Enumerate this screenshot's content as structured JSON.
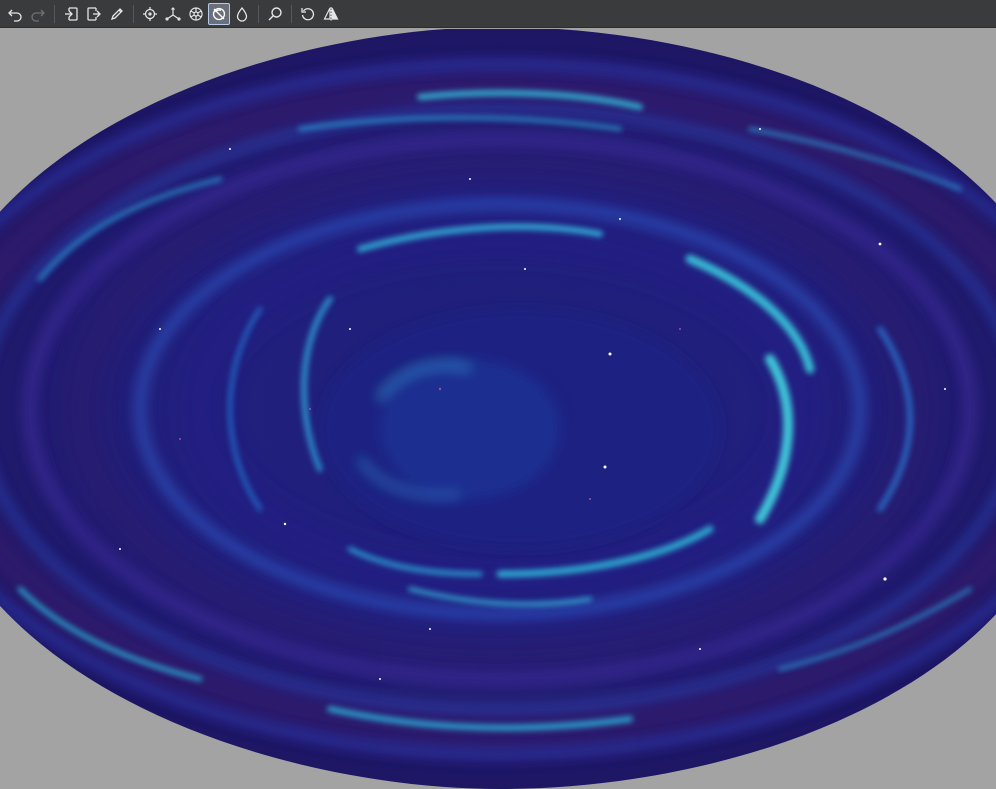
{
  "toolbar": {
    "buttons": [
      {
        "name": "undo-button",
        "icon": "undo-icon",
        "enabled": true
      },
      {
        "name": "redo-button",
        "icon": "redo-icon",
        "enabled": false
      },
      {
        "name": "import-button",
        "icon": "import-icon",
        "enabled": true
      },
      {
        "name": "export-button",
        "icon": "export-icon",
        "enabled": true
      },
      {
        "name": "pencil-button",
        "icon": "pencil-icon",
        "enabled": true
      },
      {
        "name": "move-tool-button",
        "icon": "crosshair-icon",
        "enabled": true
      },
      {
        "name": "axis-tool-button",
        "icon": "axis-icon",
        "enabled": true
      },
      {
        "name": "sphere-tool-button",
        "icon": "wheel-icon",
        "enabled": true
      },
      {
        "name": "distortion-tool-button",
        "icon": "eye-slash-icon",
        "enabled": true,
        "active": true
      },
      {
        "name": "droplet-tool-button",
        "icon": "droplet-icon",
        "enabled": true
      },
      {
        "name": "zoom-button",
        "icon": "zoom-icon",
        "enabled": true
      },
      {
        "name": "rotate-button",
        "icon": "rotate-icon",
        "enabled": true
      },
      {
        "name": "flip-button",
        "icon": "flip-icon",
        "enabled": true
      }
    ]
  },
  "colors": {
    "toolbar_bg": "#393b3d",
    "canvas_bg": "#a3a3a3",
    "icon": "#e6e6e6",
    "icon_disabled": "#6f7174",
    "nebula_deep": "#1a1660",
    "nebula_mid": "#2a2a9a",
    "nebula_cyan": "#2fd3e0",
    "nebula_purple": "#4a1f7a"
  },
  "canvas": {
    "content": "swirled-nebula-image"
  }
}
